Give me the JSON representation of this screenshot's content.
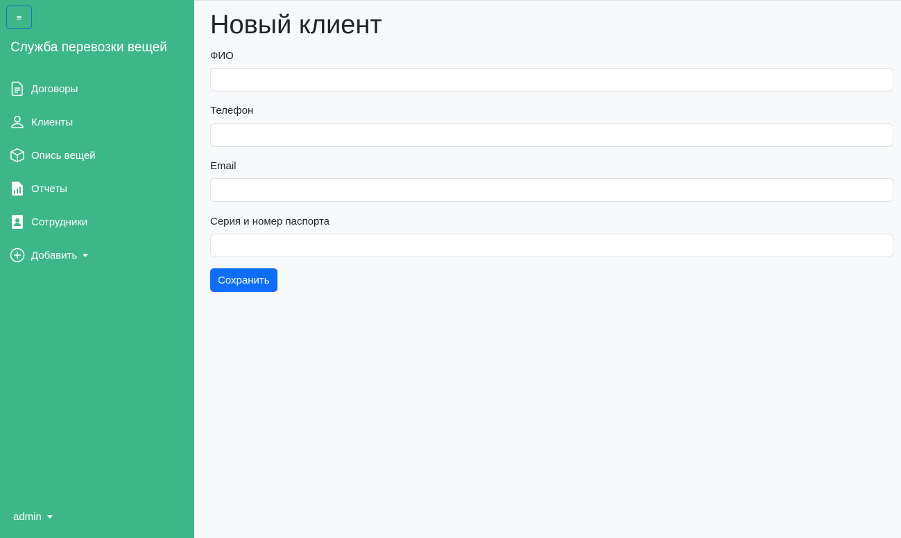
{
  "sidebar": {
    "toggle_icon": "≡",
    "brand": "Служба перевозки вещей",
    "items": [
      {
        "label": "Договоры",
        "icon": "document-icon"
      },
      {
        "label": "Клиенты",
        "icon": "person-icon"
      },
      {
        "label": "Опись вещей",
        "icon": "box-icon"
      },
      {
        "label": "Отчеты",
        "icon": "report-chart-icon"
      },
      {
        "label": "Сотрудники",
        "icon": "employee-badge-icon"
      },
      {
        "label": "Добавить",
        "icon": "plus-circle-icon"
      }
    ],
    "user": "admin",
    "background_color": "#3db788"
  },
  "main": {
    "title": "Новый клиент",
    "fields": [
      {
        "label": "ФИО",
        "value": "",
        "placeholder": ""
      },
      {
        "label": "Телефон",
        "value": "",
        "placeholder": ""
      },
      {
        "label": "Email",
        "value": "",
        "placeholder": ""
      },
      {
        "label": "Серия и номер паспорта",
        "value": "",
        "placeholder": ""
      }
    ],
    "save_label": "Сохранить",
    "accent_color": "#0d6efd"
  }
}
